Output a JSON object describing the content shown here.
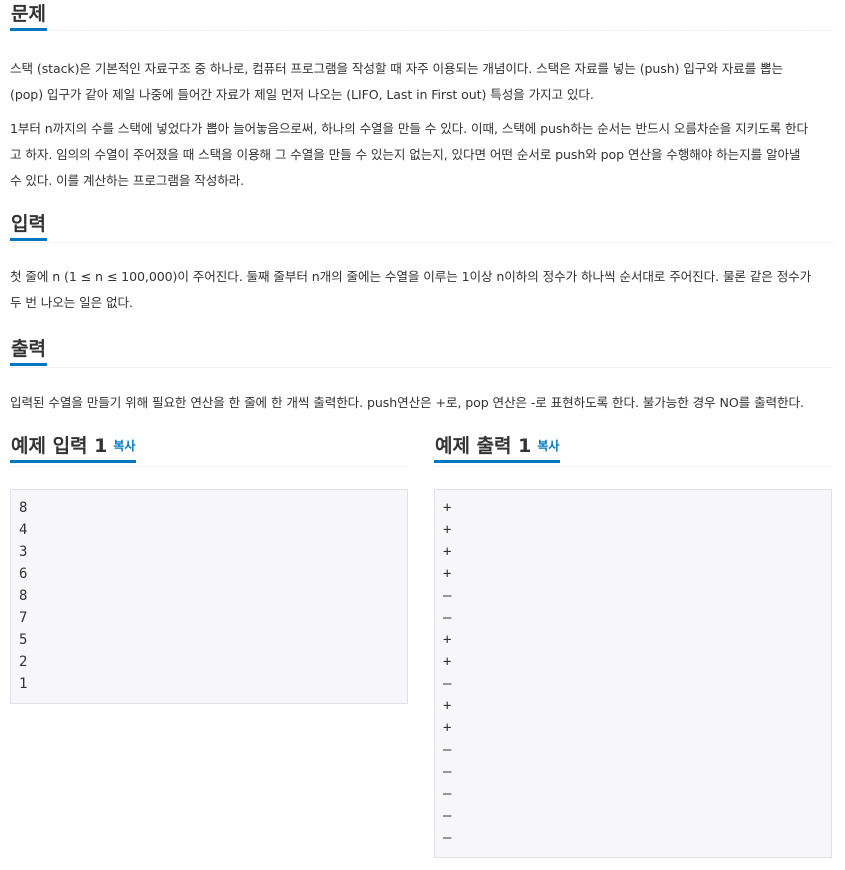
{
  "problem": {
    "title": "문제",
    "para1_line1": "스택 (stack)은 기본적인 자료구조 중 하나로, 컴퓨터 프로그램을 작성할 때 자주 이용되는 개념이다. 스택은 자료를 넣는 (push) 입구와 자료를 뽑는",
    "para1_line2": "(pop) 입구가 같아 제일 나중에 들어간 자료가 제일 먼저 나오는 (LIFO, Last in First out) 특성을 가지고 있다.",
    "para2_line1": "1부터 n까지의 수를 스택에 넣었다가 뽑아 늘어놓음으로써, 하나의 수열을 만들 수 있다. 이때, 스택에 push하는 순서는 반드시 오름차순을 지키도록 한다",
    "para2_line2": "고 하자. 임의의 수열이 주어졌을 때 스택을 이용해 그 수열을 만들 수 있는지 없는지, 있다면 어떤 순서로 push와 pop 연산을 수행해야 하는지를 알아낼",
    "para2_line3": "수 있다. 이를 계산하는 프로그램을 작성하라."
  },
  "input": {
    "title": "입력",
    "line1": "첫 줄에 n (1 ≤ n ≤ 100,000)이 주어진다. 둘째 줄부터 n개의 줄에는 수열을 이루는 1이상 n이하의 정수가 하나씩 순서대로 주어진다. 물론 같은 정수가",
    "line2": "두 번 나오는 일은 없다."
  },
  "output": {
    "title": "출력",
    "line1": "입력된 수열을 만들기 위해 필요한 연산을 한 줄에 한 개씩 출력한다. push연산은 +로, pop 연산은 -로 표현하도록 한다. 불가능한 경우 NO를 출력한다."
  },
  "sample_input": {
    "title": "예제 입력 1",
    "copy_label": "복사",
    "lines": [
      "8",
      "4",
      "3",
      "6",
      "8",
      "7",
      "5",
      "2",
      "1"
    ]
  },
  "sample_output": {
    "title": "예제 출력 1",
    "copy_label": "복사",
    "lines": [
      "+",
      "+",
      "+",
      "+",
      "–",
      "–",
      "+",
      "+",
      "–",
      "+",
      "+",
      "–",
      "–",
      "–",
      "–",
      "–"
    ]
  },
  "colors": {
    "accent": "#0076c0",
    "text": "#333333",
    "sample_bg": "#f7f7f9",
    "sample_border": "#e1e1e8"
  }
}
